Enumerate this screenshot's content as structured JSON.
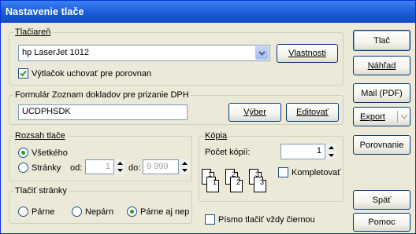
{
  "window": {
    "title": "Nastavenie tlače"
  },
  "printer": {
    "group_label": "Tlačiareň",
    "selected": "hp LaserJet 1012",
    "properties_label": "Vlastnosti",
    "keep_copy_checked": true,
    "keep_copy_label": "Výtlačok uchovať pre porovnan"
  },
  "form": {
    "group_label": "Formulár  Zoznam dokladov pre prizanie DPH",
    "value": "UCDPHSDK",
    "select_label": "Výber",
    "edit_label": "Editovať"
  },
  "range": {
    "group_label": "Rozsah tlače",
    "all_label": "Všetkého",
    "all_selected": true,
    "pages_label": "Stránky",
    "from_label": "od:",
    "from_value": "1",
    "to_label": "do:",
    "to_value": "9 999"
  },
  "print_pages": {
    "group_label": "Tlačiť stránky",
    "even_label": "Párne",
    "odd_label": "Nepárn",
    "both_label": "Párne aj nep",
    "selected": "both"
  },
  "copies": {
    "group_label": "Kópia",
    "count_label": "Počet kópií:",
    "count_value": "1",
    "collate_label": "Kompletovať",
    "collate_checked": false,
    "page_numbers": [
      "1",
      "1",
      "2",
      "2",
      "3",
      "3"
    ]
  },
  "black_font": {
    "label": "Písmo tlačiť vždy čiernou",
    "checked": false
  },
  "buttons": {
    "print": "Tlač",
    "preview": "Náhľad",
    "mail": "Mail (PDF)",
    "export": "Export",
    "compare": "Porovnanie",
    "back": "Späť",
    "help": "Pomoc"
  },
  "colors": {
    "title_bar": "#2461d6",
    "window_bg": "#ece9d8",
    "radio_dot": "#21a121",
    "check_mark": "#21a121"
  }
}
